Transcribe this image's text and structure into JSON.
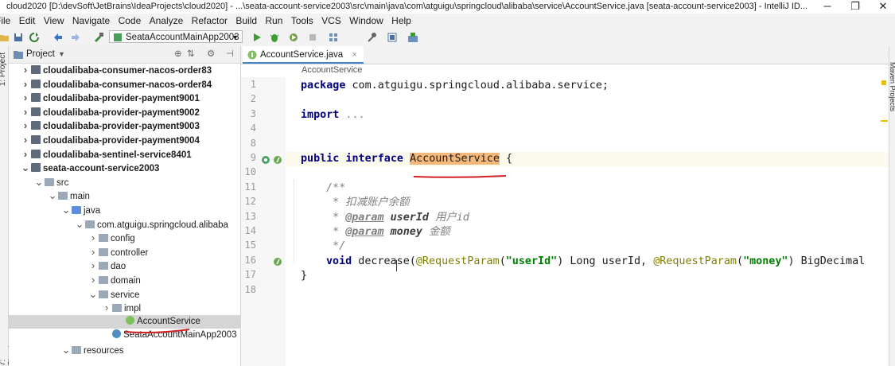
{
  "window": {
    "title": "cloud2020 [D:\\devSoft\\JetBrains\\IdeaProjects\\cloud2020] - ...\\seata-account-service2003\\src\\main\\java\\com\\atguigu\\springcloud\\alibaba\\service\\AccountService.java [seata-account-service2003] - IntelliJ ID..."
  },
  "menu": [
    "File",
    "Edit",
    "View",
    "Navigate",
    "Code",
    "Analyze",
    "Refactor",
    "Build",
    "Run",
    "Tools",
    "VCS",
    "Window",
    "Help"
  ],
  "toolbar": {
    "run_config": "SeataAccountMainApp2003"
  },
  "left_strip": {
    "project_label": "1: Project",
    "structure_label": "7: Structure"
  },
  "right_strip": {
    "maven_label": "Maven Projects"
  },
  "project_panel": {
    "title": "Project",
    "tree": [
      {
        "label": "cloudalibaba-consumer-nacos-order83",
        "depth": 0,
        "arrow": "right",
        "icon": "module",
        "bold": true
      },
      {
        "label": "cloudalibaba-consumer-nacos-order84",
        "depth": 0,
        "arrow": "right",
        "icon": "module",
        "bold": true
      },
      {
        "label": "cloudalibaba-provider-payment9001",
        "depth": 0,
        "arrow": "right",
        "icon": "module",
        "bold": true
      },
      {
        "label": "cloudalibaba-provider-payment9002",
        "depth": 0,
        "arrow": "right",
        "icon": "module",
        "bold": true
      },
      {
        "label": "cloudalibaba-provider-payment9003",
        "depth": 0,
        "arrow": "right",
        "icon": "module",
        "bold": true
      },
      {
        "label": "cloudalibaba-provider-payment9004",
        "depth": 0,
        "arrow": "right",
        "icon": "module",
        "bold": true
      },
      {
        "label": "cloudalibaba-sentinel-service8401",
        "depth": 0,
        "arrow": "right",
        "icon": "module",
        "bold": true
      },
      {
        "label": "seata-account-service2003",
        "depth": 0,
        "arrow": "down",
        "icon": "module",
        "bold": true
      },
      {
        "label": "src",
        "depth": 1,
        "arrow": "down",
        "icon": "folder",
        "bold": false
      },
      {
        "label": "main",
        "depth": 2,
        "arrow": "down",
        "icon": "folder",
        "bold": false
      },
      {
        "label": "java",
        "depth": 3,
        "arrow": "down",
        "icon": "folder-blue",
        "bold": false
      },
      {
        "label": "com.atguigu.springcloud.alibaba",
        "depth": 4,
        "arrow": "down",
        "icon": "folder",
        "bold": false
      },
      {
        "label": "config",
        "depth": 5,
        "arrow": "right",
        "icon": "folder",
        "bold": false
      },
      {
        "label": "controller",
        "depth": 5,
        "arrow": "right",
        "icon": "folder",
        "bold": false
      },
      {
        "label": "dao",
        "depth": 5,
        "arrow": "right",
        "icon": "folder",
        "bold": false
      },
      {
        "label": "domain",
        "depth": 5,
        "arrow": "right",
        "icon": "folder",
        "bold": false
      },
      {
        "label": "service",
        "depth": 5,
        "arrow": "down",
        "icon": "folder",
        "bold": false
      },
      {
        "label": "impl",
        "depth": 6,
        "arrow": "right",
        "icon": "folder",
        "bold": false
      },
      {
        "label": "AccountService",
        "depth": 7,
        "arrow": "none",
        "icon": "interface",
        "bold": false,
        "selected": true
      },
      {
        "label": "SeataAccountMainApp2003",
        "depth": 6,
        "arrow": "none",
        "icon": "class-main",
        "bold": false
      },
      {
        "label": "resources",
        "depth": 3,
        "arrow": "down",
        "icon": "folder",
        "bold": false
      }
    ]
  },
  "editor": {
    "tab_label": "AccountService.java",
    "breadcrumb": "AccountService",
    "line_numbers": [
      "1",
      "2",
      "3",
      "4",
      "8",
      "9",
      "10",
      "11",
      "12",
      "13",
      "14",
      "15",
      "16",
      "17",
      "18"
    ],
    "lines": {
      "l1": {
        "kw": "package",
        "rest": " com.atguigu.springcloud.alibaba.service;"
      },
      "l3": {
        "kw": "import",
        "rest": " ..."
      },
      "l9": {
        "kw1": "public",
        "kw2": "interface",
        "name": "AccountService",
        "rest": " {"
      },
      "l11": "/**",
      "l12": " * 扣减账户余额",
      "l13": {
        "star": " * ",
        "tag": "@param",
        "name": "userId",
        "desc": "用户id"
      },
      "l14": {
        "star": " * ",
        "tag": "@param",
        "name": "money",
        "desc": "金额"
      },
      "l15": " */",
      "l16": {
        "kw": "void",
        "m": " decrease(",
        "a1": "@RequestParam",
        "p1": "(",
        "s1": "\"userId\"",
        "m2": ") Long userId, ",
        "a2": "@RequestParam",
        "p2": "(",
        "s2": "\"money\"",
        "m3": ") BigDecimal"
      },
      "l17": "}"
    }
  }
}
